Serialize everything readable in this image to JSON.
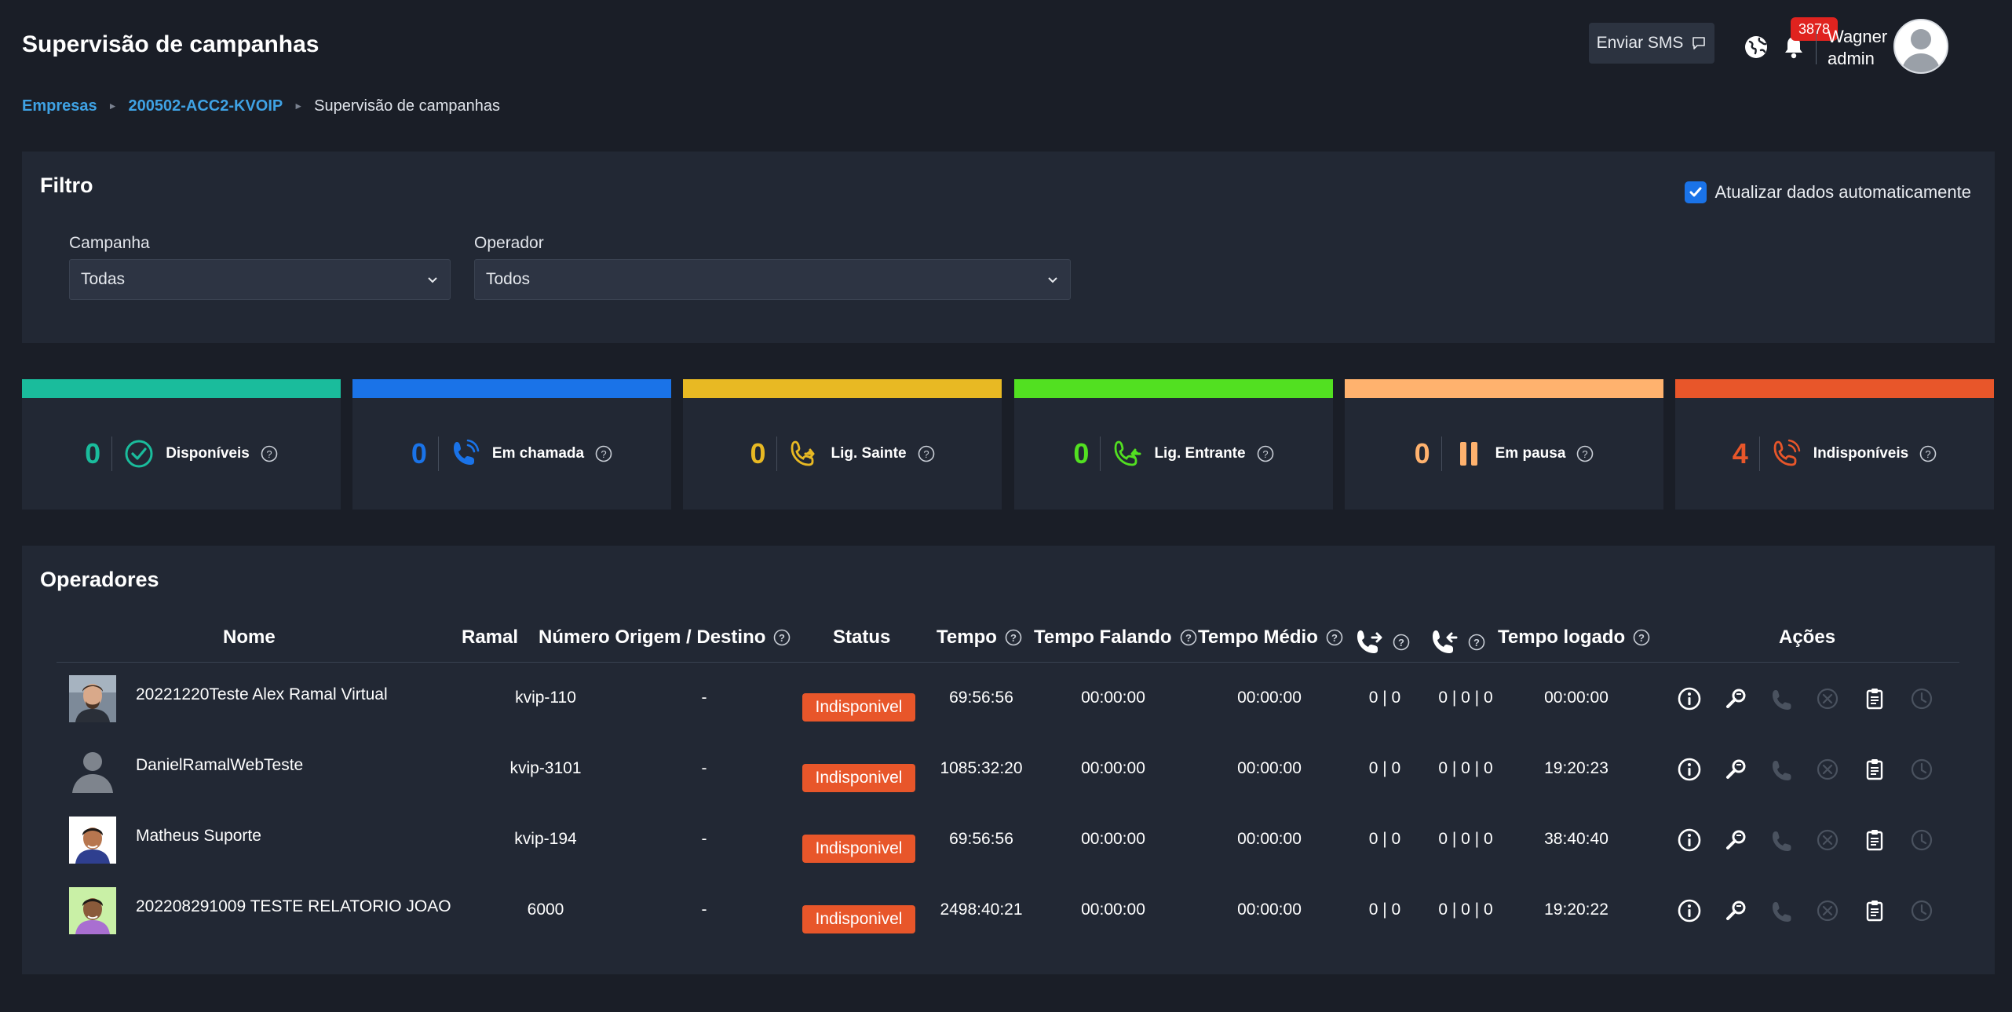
{
  "header": {
    "title": "Supervisão de campanhas",
    "sms_button": "Enviar SMS",
    "notification_count": "3878",
    "user_first_name": "Wagner",
    "user_role": "admin"
  },
  "breadcrumb": {
    "items": [
      "Empresas",
      "200502-ACC2-KVOIP"
    ],
    "current": "Supervisão de campanhas"
  },
  "filter": {
    "title": "Filtro",
    "auto_update_label": "Atualizar dados automaticamente",
    "auto_update_checked": true,
    "campaign_label": "Campanha",
    "campaign_value": "Todas",
    "operator_label": "Operador",
    "operator_value": "Todos"
  },
  "status_cards": [
    {
      "count": "0",
      "label": "Disponíveis",
      "color": "#1abc9c",
      "icon": "check-circle-icon"
    },
    {
      "count": "0",
      "label": "Em chamada",
      "color": "#1a73e8",
      "icon": "phone-icon"
    },
    {
      "count": "0",
      "label": "Lig. Sainte",
      "color": "#e8b923",
      "icon": "phone-outgoing-icon"
    },
    {
      "count": "0",
      "label": "Lig. Entrante",
      "color": "#52e021",
      "icon": "phone-incoming-icon"
    },
    {
      "count": "0",
      "label": "Em pausa",
      "color": "#ffb26e",
      "icon": "pause-icon"
    },
    {
      "count": "4",
      "label": "Indisponíveis",
      "color": "#e8562a",
      "icon": "phone-off-icon"
    }
  ],
  "operators": {
    "title": "Operadores",
    "columns": {
      "name": "Nome",
      "extension": "Ramal",
      "number": "Número Origem / Destino",
      "status": "Status",
      "time": "Tempo",
      "talk_time": "Tempo Falando",
      "avg_time": "Tempo Médio",
      "logged_time": "Tempo logado",
      "actions": "Ações"
    },
    "rows": [
      {
        "name": "20221220Teste Alex Ramal Virtual",
        "extension": "kvip-110",
        "number": "-",
        "status": "Indisponivel",
        "time": "69:56:56",
        "talk_time": "00:00:00",
        "avg_time": "00:00:00",
        "outgoing": "0 | 0",
        "incoming": "0 | 0 | 0",
        "logged_time": "00:00:00",
        "avatar": "photo-man"
      },
      {
        "name": "DanielRamalWebTeste",
        "extension": "kvip-3101",
        "number": "-",
        "status": "Indisponivel",
        "time": "1085:32:20",
        "talk_time": "00:00:00",
        "avg_time": "00:00:00",
        "outgoing": "0 | 0",
        "incoming": "0 | 0 | 0",
        "logged_time": "19:20:23",
        "avatar": "default-user"
      },
      {
        "name": "Matheus Suporte",
        "extension": "kvip-194",
        "number": "-",
        "status": "Indisponivel",
        "time": "69:56:56",
        "talk_time": "00:00:00",
        "avg_time": "00:00:00",
        "outgoing": "0 | 0",
        "incoming": "0 | 0 | 0",
        "logged_time": "38:40:40",
        "avatar": "cartoon-man-blue"
      },
      {
        "name": "202208291009 TESTE RELATORIO JOAO",
        "extension": "6000",
        "number": "-",
        "status": "Indisponivel",
        "time": "2498:40:21",
        "talk_time": "00:00:00",
        "avg_time": "00:00:00",
        "outgoing": "0 | 0",
        "incoming": "0 | 0 | 0",
        "logged_time": "19:20:22",
        "avatar": "cartoon-man-green"
      }
    ]
  }
}
